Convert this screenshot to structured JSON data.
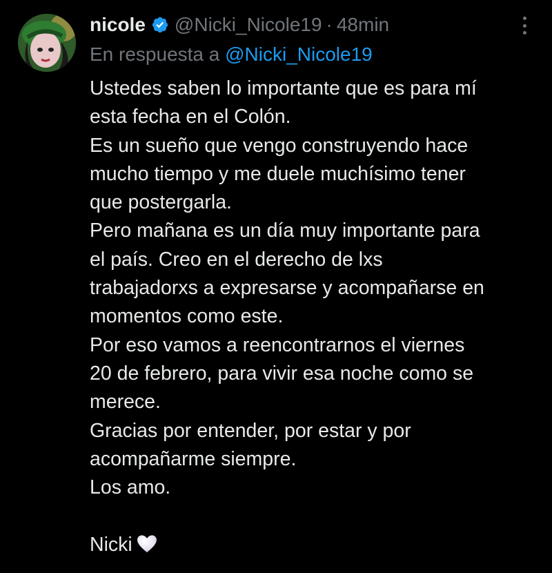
{
  "tweet": {
    "display_name": "nicole",
    "handle": "@Nicki_Nicole19",
    "separator": "·",
    "time": "48min",
    "reply_prefix": "En respuesta a ",
    "reply_handle": "@Nicki_Nicole19",
    "body_lines": [
      "Ustedes saben lo importante que es para mí",
      "esta fecha en el Colón.",
      "Es un sueño que vengo construyendo hace",
      "mucho tiempo y me duele muchísimo tener",
      "que postergarla.",
      "Pero mañana es un día muy importante para",
      "el país. Creo en el derecho de lxs",
      "trabajadorxs a expresarse y acompañarse en",
      "momentos como este.",
      "Por eso vamos a reencontrarnos el viernes",
      "20 de febrero, para vivir esa noche como se",
      "merece.",
      "Gracias por entender, por estar y por",
      "acompañarme siempre.",
      "Los amo.",
      "",
      "Nicki"
    ],
    "signature_emoji": "white-heart-icon"
  },
  "colors": {
    "background": "#000000",
    "text_primary": "#e7e9ea",
    "text_secondary": "#71767b",
    "link": "#1d9bf0",
    "verified_badge": "#1d9bf0"
  },
  "icons": {
    "verified": "verified-badge-icon",
    "more": "more-options-icon",
    "heart": "white-heart-icon"
  }
}
